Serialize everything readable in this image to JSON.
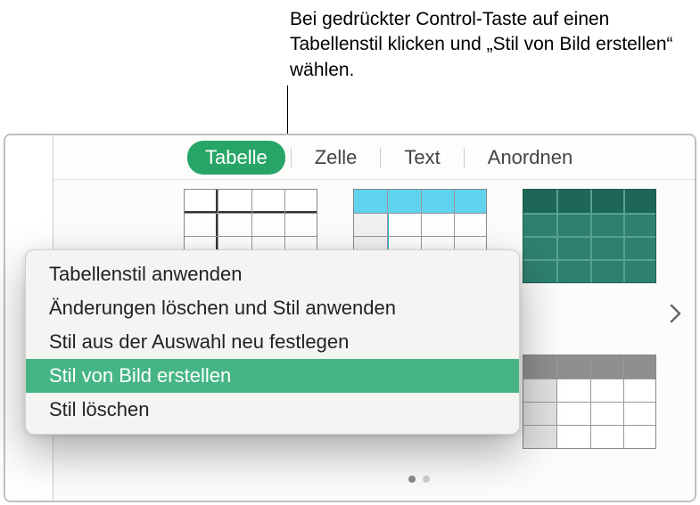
{
  "callout": {
    "text": "Bei gedrückter Control-Taste auf einen Tabellenstil klicken und „Stil von Bild erstellen“ wählen."
  },
  "tabs": {
    "table": "Tabelle",
    "cell": "Zelle",
    "text": "Text",
    "arrange": "Anordnen"
  },
  "context_menu": {
    "apply_style": "Tabellenstil anwenden",
    "clear_and_apply": "Änderungen löschen und Stil anwenden",
    "redefine_from_selection": "Stil aus der Auswahl neu festlegen",
    "create_from_image": "Stil von Bild erstellen",
    "delete_style": "Stil löschen"
  },
  "colors": {
    "accent": "#27a566",
    "highlight": "#46b585"
  }
}
